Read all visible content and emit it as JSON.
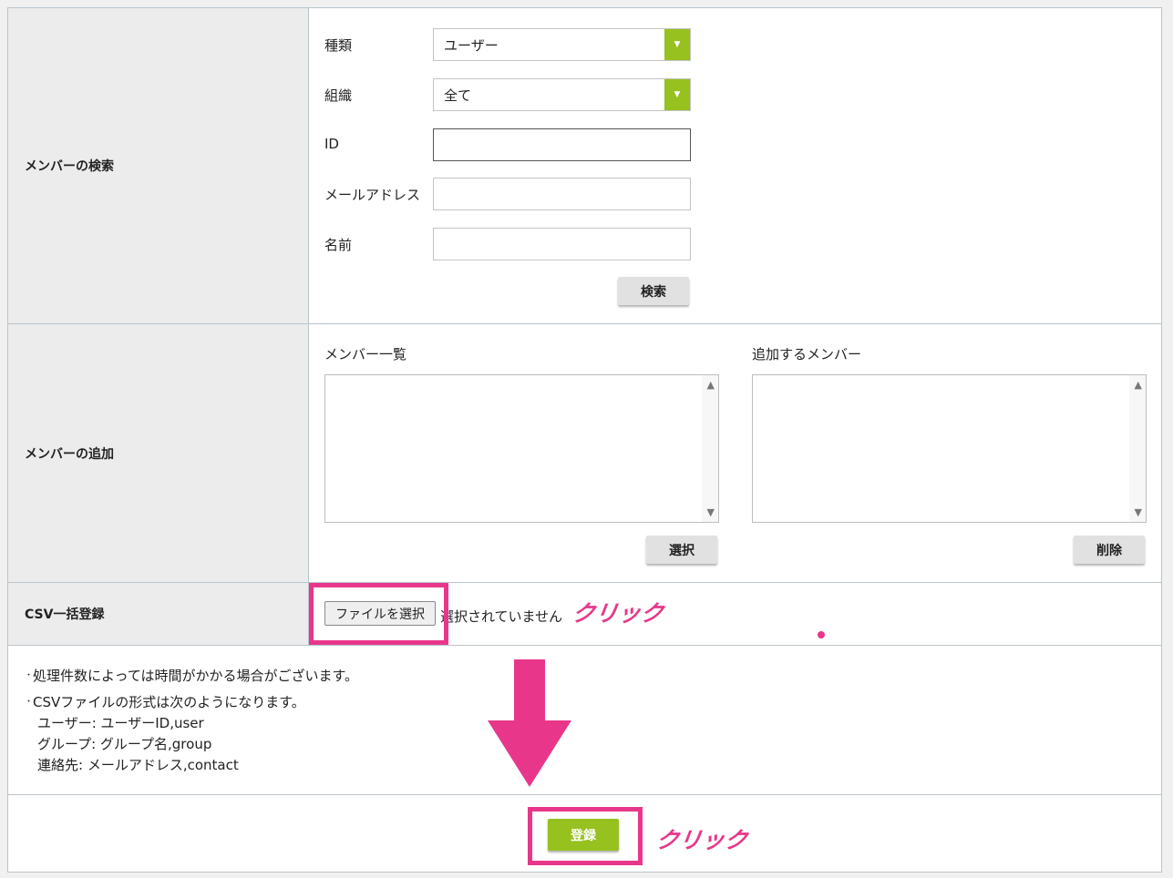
{
  "search": {
    "section_label": "メンバーの検索",
    "type_label": "種類",
    "type_value": "ユーザー",
    "org_label": "組織",
    "org_value": "全て",
    "id_label": "ID",
    "email_label": "メールアドレス",
    "name_label": "名前",
    "search_button": "検索"
  },
  "add": {
    "section_label": "メンバーの追加",
    "members_list_label": "メンバー一覧",
    "add_list_label": "追加するメンバー",
    "select_button": "選択",
    "delete_button": "削除"
  },
  "csv": {
    "section_label": "CSV一括登録",
    "file_button": "ファイルを選択",
    "file_status": "選択されていません",
    "click_annotation": "クリック"
  },
  "notes": {
    "line1": "処理件数によっては時間がかかる場合がございます。",
    "line2": "CSVファイルの形式は次のようになります。",
    "line3": "ユーザー: ユーザーID,user",
    "line4": "グループ: グループ名,group",
    "line5": "連絡先: メールアドレス,contact"
  },
  "footer": {
    "register_button": "登録",
    "click_annotation": "クリック"
  },
  "colors": {
    "accent_green": "#96c11f",
    "highlight_pink": "#e8378a"
  },
  "icons": {
    "dropdown": "triangle-down",
    "scroll_up": "triangle-up",
    "scroll_down": "triangle-down"
  }
}
